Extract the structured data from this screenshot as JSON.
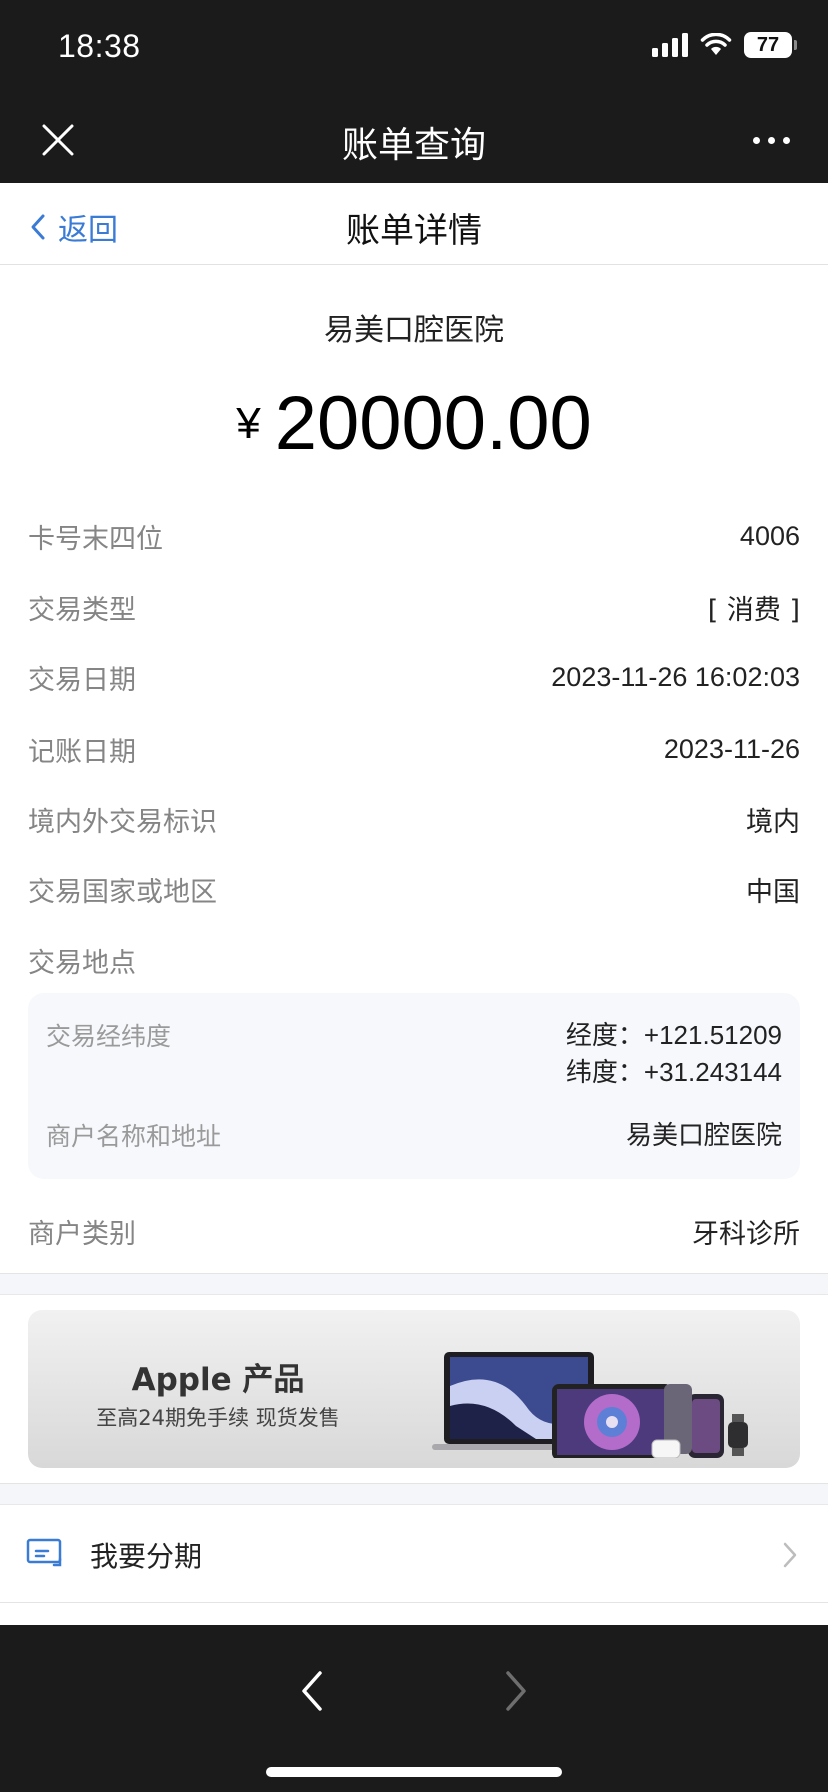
{
  "status": {
    "time": "18:38",
    "battery": "77"
  },
  "nav": {
    "title": "账单查询"
  },
  "header": {
    "back_label": "返回",
    "title": "账单详情"
  },
  "bill": {
    "merchant": "易美口腔医院",
    "currency": "¥",
    "amount": "20000.00",
    "rows": [
      {
        "label": "卡号末四位",
        "value": "4006"
      },
      {
        "label": "交易类型",
        "value": "[ 消费 ]"
      },
      {
        "label": "交易日期",
        "value": "2023-11-26 16:02:03"
      },
      {
        "label": "记账日期",
        "value": "2023-11-26"
      },
      {
        "label": "境内外交易标识",
        "value": "境内"
      },
      {
        "label": "交易国家或地区",
        "value": "中国"
      },
      {
        "label": "交易地点",
        "value": ""
      }
    ],
    "location": {
      "coords_label": "交易经纬度",
      "longitude": "经度：+121.51209",
      "latitude": "纬度：+31.243144",
      "merchant_label": "商户名称和地址",
      "merchant_value": "易美口腔医院"
    },
    "category": {
      "label": "商户类别",
      "value": "牙科诊所"
    }
  },
  "banner": {
    "title": "Apple 产品",
    "subtitle": "至高24期免手续 现货发售"
  },
  "installment": {
    "label": "我要分期"
  },
  "colors": {
    "accent": "#3a7bd5",
    "dark_bar": "#1b1b1b"
  }
}
